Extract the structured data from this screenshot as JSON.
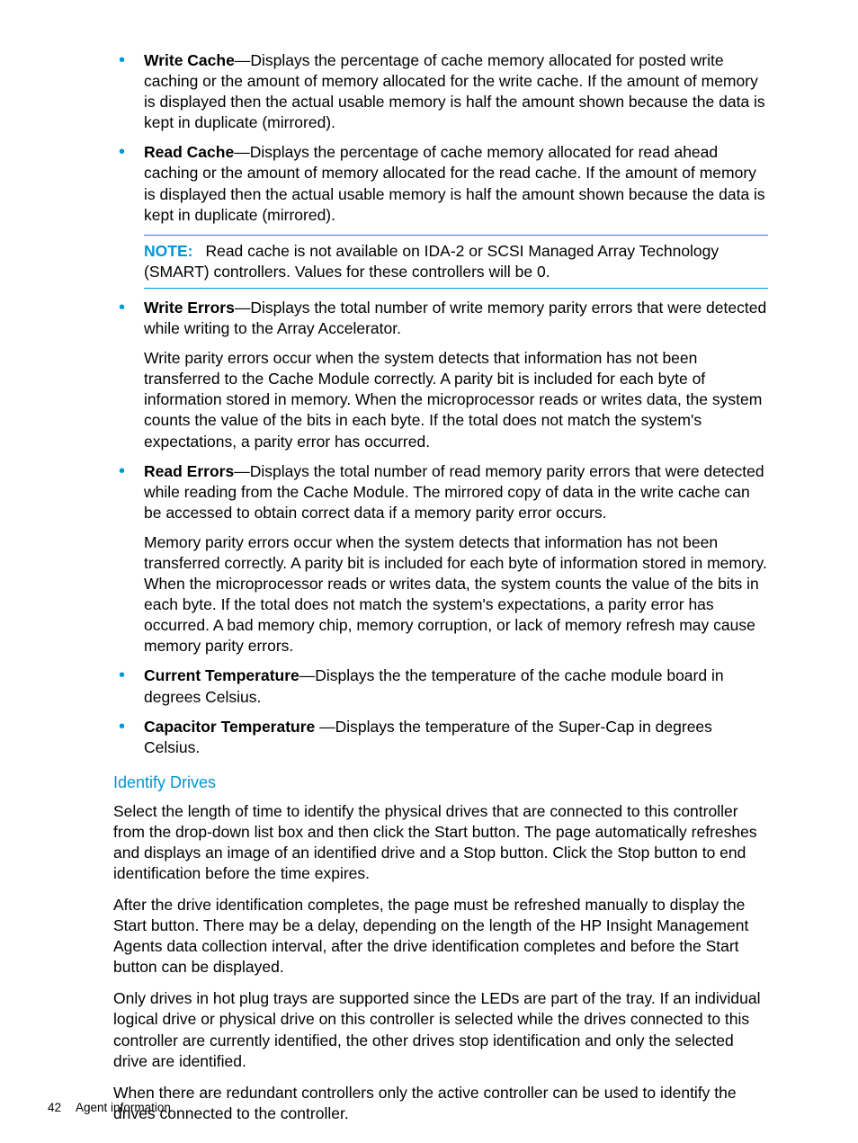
{
  "bullets": [
    {
      "term": "Write Cache",
      "desc": "—Displays the percentage of cache memory allocated for posted write caching or the amount of memory allocated for the write cache. If the amount of memory is displayed then the actual usable memory is half the amount shown because the data is kept in duplicate (mirrored)."
    },
    {
      "term": "Read Cache",
      "desc": "—Displays the percentage of cache memory allocated for read ahead caching or the amount of memory allocated for the read cache. If the amount of memory is displayed then the actual usable memory is half the amount shown because the data is kept in duplicate (mirrored).",
      "note_label": "NOTE:",
      "note_text": "Read cache is not available on IDA-2 or SCSI Managed Array Technology (SMART) controllers. Values for these controllers will be 0."
    },
    {
      "term": "Write Errors",
      "desc": "—Displays the total number of write memory parity errors that were detected while writing to the Array Accelerator.",
      "extra": "Write parity errors occur when the system detects that information has not been transferred to the Cache Module correctly. A parity bit is included for each byte of information stored in memory. When the microprocessor reads or writes data, the system counts the value of the bits in each byte. If the total does not match the system's expectations, a parity error has occurred."
    },
    {
      "term": "Read Errors",
      "desc": "—Displays the total number of read memory parity errors that were detected while reading from the Cache Module. The mirrored copy of data in the write cache can be accessed to obtain correct data if a memory parity error occurs.",
      "extra": "Memory parity errors occur when the system detects that information has not been transferred correctly. A parity bit is included for each byte of information stored in memory. When the microprocessor reads or writes data, the system counts the value of the bits in each byte. If the total does not match the system's expectations, a parity error has occurred. A bad memory chip, memory corruption, or lack of memory refresh may cause memory parity errors."
    },
    {
      "term": "Current Temperature",
      "desc": "—Displays the the temperature of the cache module board in degrees Celsius."
    },
    {
      "term": "Capacitor Temperature ",
      "desc": "—Displays the temperature of the Super-Cap in degrees Celsius."
    }
  ],
  "section": {
    "heading": "Identify Drives",
    "paras": [
      "Select the length of time to identify the physical drives that are connected to this controller from the drop-down list box and then click the Start button. The page automatically refreshes and displays an image of an identified drive and a Stop button. Click the Stop button to end identification before the time expires.",
      "After the drive identification completes, the page must be refreshed manually to display the Start button. There may be a delay, depending on the length of the HP Insight Management Agents data collection interval, after the drive identification completes and before the Start button can be displayed.",
      "Only drives in hot plug trays are supported since the LEDs are part of the tray. If an individual logical drive or physical drive on this controller is selected while the drives connected to this controller are currently identified, the other drives stop identification and only the selected drive are identified.",
      "When there are redundant controllers only the active controller can be used to identify the drives connected to the controller."
    ]
  },
  "footer": {
    "page": "42",
    "title": "Agent information"
  }
}
